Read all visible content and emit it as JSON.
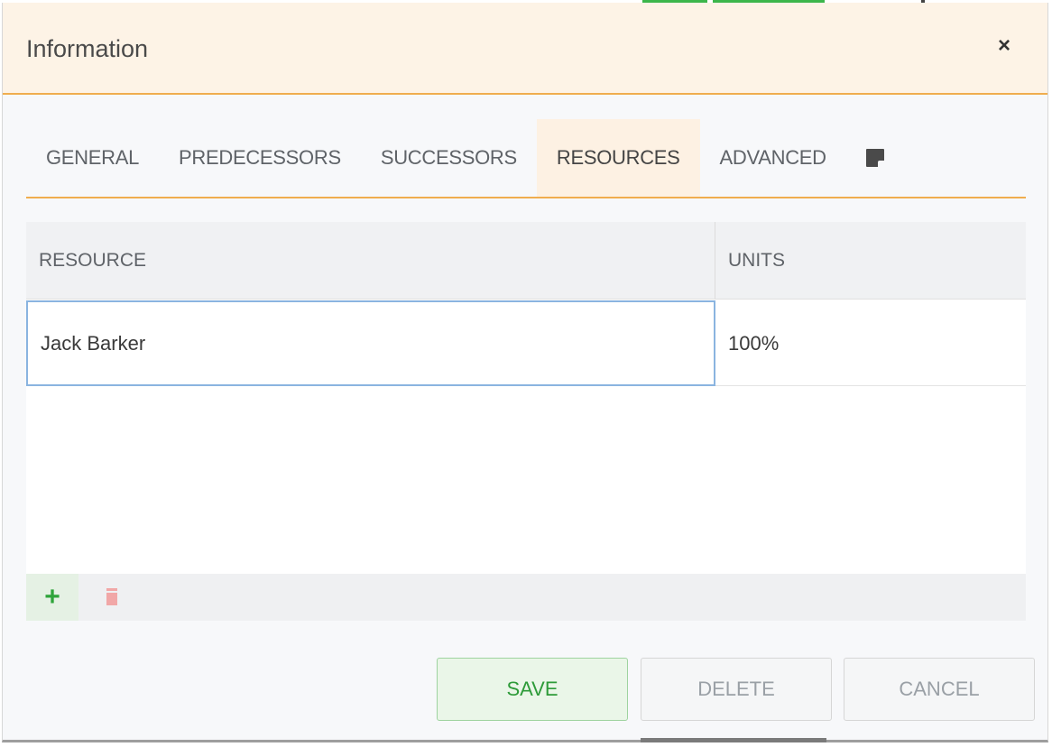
{
  "dialog": {
    "title": "Information",
    "close_label": "×"
  },
  "tabs": [
    {
      "label": "GENERAL",
      "active": false
    },
    {
      "label": "PREDECESSORS",
      "active": false
    },
    {
      "label": "SUCCESSORS",
      "active": false
    },
    {
      "label": "RESOURCES",
      "active": true
    },
    {
      "label": "ADVANCED",
      "active": false
    }
  ],
  "notes_tab_icon": "note-icon",
  "grid": {
    "columns": [
      "RESOURCE",
      "UNITS"
    ],
    "rows": [
      {
        "resource": "Jack Barker",
        "units": "100%"
      }
    ],
    "toolbar": {
      "add_label": "+",
      "add_icon": "plus-icon",
      "remove_icon": "trash-icon"
    }
  },
  "buttons": {
    "save": "SAVE",
    "delete": "DELETE",
    "cancel": "CANCEL"
  },
  "colors": {
    "accent": "#f0ad4e",
    "header_bg": "#fdf3e6",
    "save_green": "#2e9b39",
    "trash_red": "#f1a7a7"
  }
}
